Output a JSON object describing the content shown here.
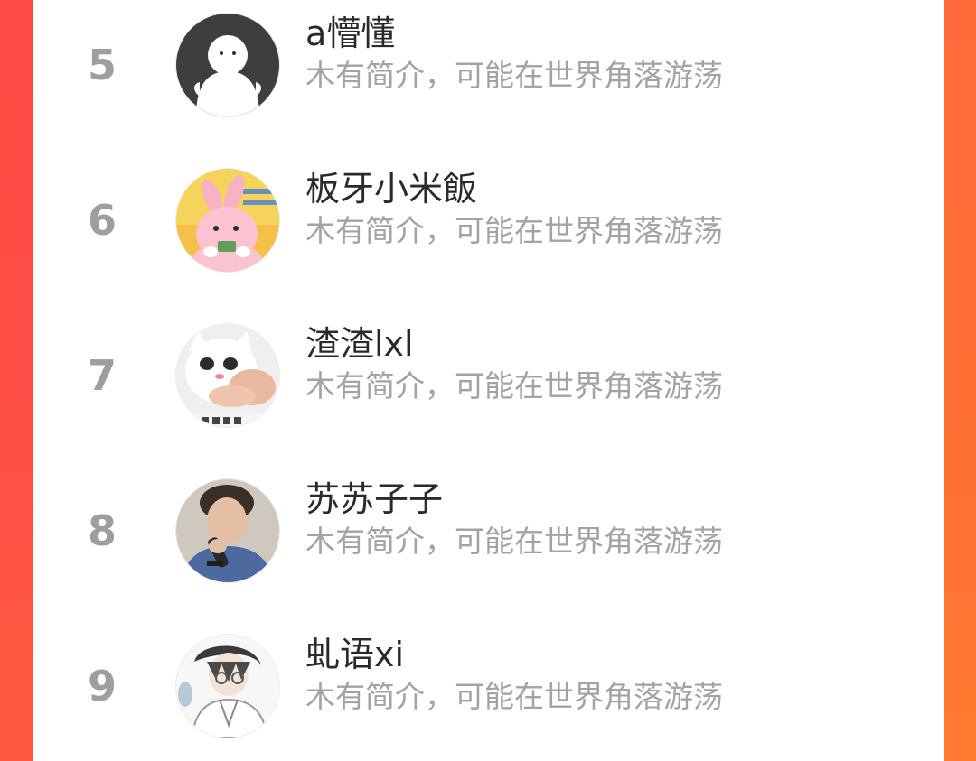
{
  "ranking": {
    "rows": [
      {
        "rank": "5",
        "name": "a懵懂",
        "bio": "木有简介，可能在世界角落游荡",
        "avatar_icon": "default-ghost-avatar-icon"
      },
      {
        "rank": "6",
        "name": "板牙小米飯",
        "bio": "木有简介，可能在世界角落游荡",
        "avatar_icon": "pink-bunny-avatar-icon"
      },
      {
        "rank": "7",
        "name": "渣渣lxl",
        "bio": "木有简介，可能在世界角落游荡",
        "avatar_icon": "crying-cat-avatar-icon"
      },
      {
        "rank": "8",
        "name": "苏苏子子",
        "bio": "木有简介，可能在世界角落游荡",
        "avatar_icon": "singer-photo-avatar-icon"
      },
      {
        "rank": "9",
        "name": "虬语xi",
        "bio": "木有简介，可能在世界角落游荡",
        "avatar_icon": "anime-boy-avatar-icon"
      }
    ]
  },
  "colors": {
    "accent_left": "#ff4a45",
    "accent_right": "#ff7033",
    "rank_text": "#9e9e9e",
    "name_text": "#2a2a2a",
    "bio_text": "#a3a3a3",
    "panel_bg": "#ffffff"
  }
}
